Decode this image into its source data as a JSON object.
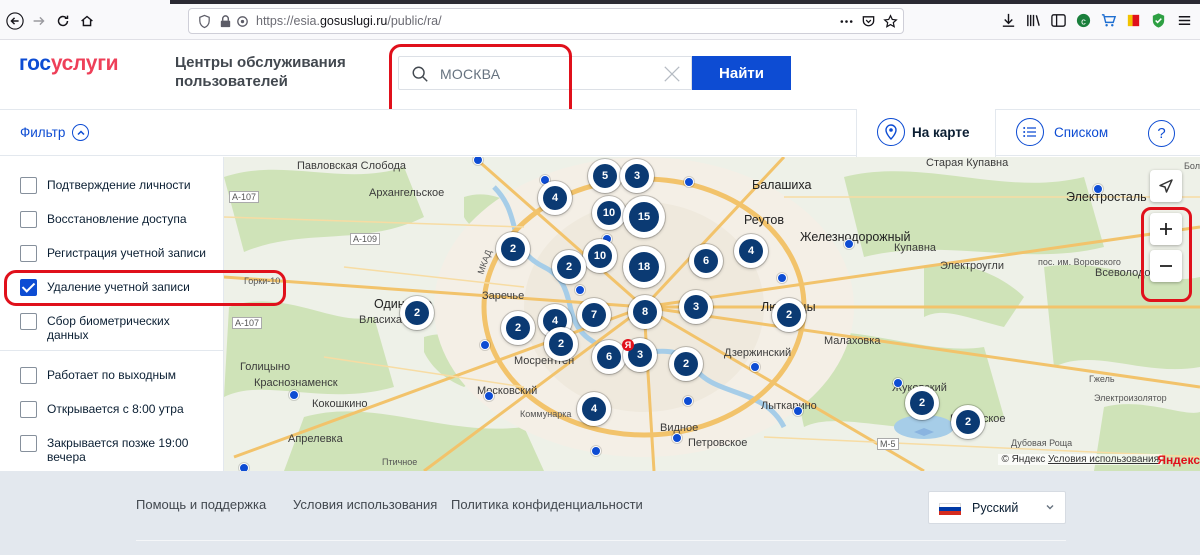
{
  "browser": {
    "url_prefix": "https://esia.",
    "url_domain": "gosuslugi.ru",
    "url_path": "/public/ra/"
  },
  "header": {
    "logo_part1": "гос",
    "logo_part2": "услуги",
    "title": "Центры обслуживания пользователей",
    "search_value": "МОСКВА",
    "find_button": "Найти"
  },
  "toolbar": {
    "filter_label": "Фильтр",
    "map_view": "На карте",
    "list_view": "Списком",
    "help": "?"
  },
  "filters": [
    {
      "label": "Подтверждение личности",
      "checked": false
    },
    {
      "label": "Восстановление доступа",
      "checked": false
    },
    {
      "label": "Регистрация учетной записи",
      "checked": false
    },
    {
      "label": "Удаление учетной записи",
      "checked": true
    },
    {
      "label": "Сбор биометрических данных",
      "checked": false
    },
    {
      "label": "Работает по выходным",
      "checked": false
    },
    {
      "label": "Открывается с 8:00 утра",
      "checked": false
    },
    {
      "label": "Закрывается позже 19:00 вечера",
      "checked": false
    }
  ],
  "map": {
    "places": [
      "Павловская Слобода",
      "Архангельское",
      "Балашиха",
      "Старая Купавна",
      "Электросталь",
      "Реутов",
      "Железнодорожный",
      "Купавна",
      "Электроугли",
      "пос. им. Воровского",
      "Всеволодово",
      "Горки-10",
      "Одинцово",
      "Власиха",
      "Заречье",
      "Люберцы",
      "Малаховка",
      "Мосрентген",
      "Голицыно",
      "Краснознаменск",
      "Московский",
      "Дзержинский",
      "Коммунарка",
      "Лыткарино",
      "Жуковский",
      "Раменское",
      "Гжель",
      "Кокошкино",
      "Апрелевка",
      "Видное",
      "Петровское",
      "Дубовая Роща",
      "Птичное",
      "Электроизолятор",
      "Боль"
    ],
    "roads": [
      "А-107",
      "А-109",
      "М-5",
      "МКАД"
    ],
    "clusters": [
      "5",
      "3",
      "4",
      "10",
      "15",
      "2",
      "10",
      "18",
      "6",
      "4",
      "2",
      "2",
      "4",
      "7",
      "8",
      "3",
      "2",
      "2",
      "6",
      "3",
      "2",
      "2",
      "4",
      "2"
    ],
    "pin_label": "Я",
    "copyright": "© Яндекс",
    "terms": "Условия использования",
    "brand": "Яндекс"
  },
  "footer": {
    "links": [
      "Помощь и поддержка",
      "Условия использования",
      "Политика конфиденциальности"
    ],
    "language": "Русский"
  }
}
